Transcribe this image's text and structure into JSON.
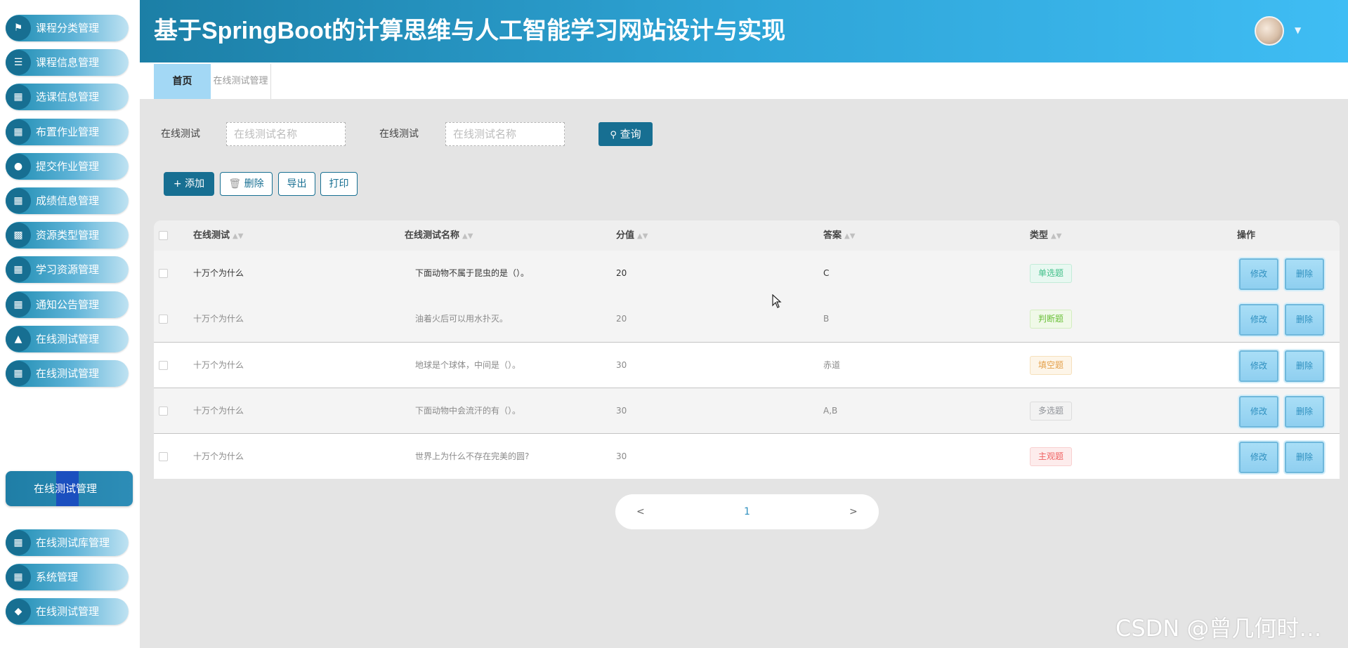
{
  "header": {
    "title": "基于SpringBoot的计算思维与人工智能学习网站设计与实现"
  },
  "sidebar": {
    "items": [
      {
        "label": "课程分类管理",
        "icon": "flag-icon"
      },
      {
        "label": "课程信息管理",
        "icon": "list-icon"
      },
      {
        "label": "选课信息管理",
        "icon": "grid-icon"
      },
      {
        "label": "布置作业管理",
        "icon": "grid-icon"
      },
      {
        "label": "提交作业管理",
        "icon": "user-icon"
      },
      {
        "label": "成绩信息管理",
        "icon": "grid-icon"
      },
      {
        "label": "资源类型管理",
        "icon": "briefcase-icon"
      },
      {
        "label": "学习资源管理",
        "icon": "grid-icon"
      },
      {
        "label": "通知公告管理",
        "icon": "table-icon"
      },
      {
        "label": "在线测试管理",
        "icon": "chart-icon"
      },
      {
        "label": "在线测试管理",
        "icon": "grid-icon"
      }
    ],
    "active_item": "在线测试管理",
    "items_after": [
      {
        "label": "在线测试库管理",
        "icon": "grid-icon"
      },
      {
        "label": "系统管理",
        "icon": "grid-icon"
      },
      {
        "label": "在线测试管理",
        "icon": "trophy-icon"
      }
    ]
  },
  "tabs": {
    "home": "首页",
    "current": "在线测试管理"
  },
  "search": {
    "label1": "在线测试",
    "placeholder1": "在线测试名称",
    "label2": "在线测试",
    "placeholder2": "在线测试名称",
    "query_label": "查询"
  },
  "actions": {
    "add": "添加",
    "delete": "删除",
    "export": "导出",
    "print": "打印"
  },
  "table": {
    "columns": [
      "在线测试",
      "在线测试名称",
      "分值",
      "答案",
      "类型",
      "操作"
    ],
    "rows": [
      {
        "test": "十万个为什么",
        "name": "下面动物不属于昆虫的是（）。",
        "score": "20",
        "answer": "C",
        "type": "单选题"
      },
      {
        "test": "十万个为什么",
        "name": "油着火后可以用水扑灭。",
        "score": "20",
        "answer": "B",
        "type": "判断题"
      },
      {
        "test": "十万个为什么",
        "name": "地球是个球体，中间是（）。",
        "score": "30",
        "answer": "赤道",
        "type": "填空题"
      },
      {
        "test": "十万个为什么",
        "name": "下面动物中会流汗的有（）。",
        "score": "30",
        "answer": "A,B",
        "type": "多选题"
      },
      {
        "test": "十万个为什么",
        "name": "世界上为什么不存在完美的圆?",
        "score": "30",
        "answer": "",
        "type": "主观题"
      }
    ],
    "edit_label": "修改",
    "delete_label": "删除"
  },
  "tag_colors": {
    "单选题": {
      "bg": "#e8f8f1",
      "border": "#c2ecd8",
      "color": "#42c08a"
    },
    "判断题": {
      "bg": "#f0f9e8",
      "border": "#d3edc0",
      "color": "#6cc13b"
    },
    "填空题": {
      "bg": "#fdf5e8",
      "border": "#f6e0bc",
      "color": "#e4a14b"
    },
    "多选题": {
      "bg": "#f2f2f2",
      "border": "#dcdcdc",
      "color": "#909399"
    },
    "主观题": {
      "bg": "#fdecec",
      "border": "#f8cfcf",
      "color": "#f06363"
    }
  },
  "pagination": {
    "prev": "<",
    "page": "1",
    "next": ">"
  },
  "watermark": "CSDN @曾几何时…"
}
